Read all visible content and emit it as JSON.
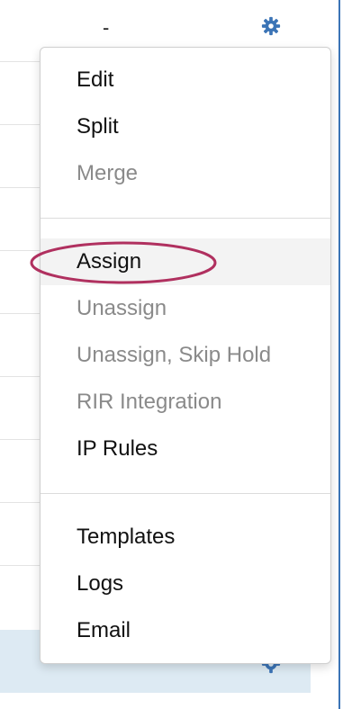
{
  "row": {
    "value": "-",
    "gear_icon": "gear-icon"
  },
  "menu": {
    "items": [
      {
        "label": "Edit",
        "enabled": true
      },
      {
        "label": "Split",
        "enabled": true
      },
      {
        "label": "Merge",
        "enabled": false
      },
      {
        "label": "Assign",
        "enabled": true,
        "highlighted": true
      },
      {
        "label": "Unassign",
        "enabled": false
      },
      {
        "label": "Unassign, Skip Hold",
        "enabled": false
      },
      {
        "label": "RIR Integration",
        "enabled": false
      },
      {
        "label": "IP Rules",
        "enabled": true
      },
      {
        "label": "Templates",
        "enabled": true
      },
      {
        "label": "Logs",
        "enabled": true
      },
      {
        "label": "Email",
        "enabled": true
      }
    ]
  },
  "colors": {
    "accent": "#3b74b6",
    "annotation": "#b0305f",
    "disabled_text": "#8a8a8a",
    "selected_row": "#ddeaf3"
  }
}
